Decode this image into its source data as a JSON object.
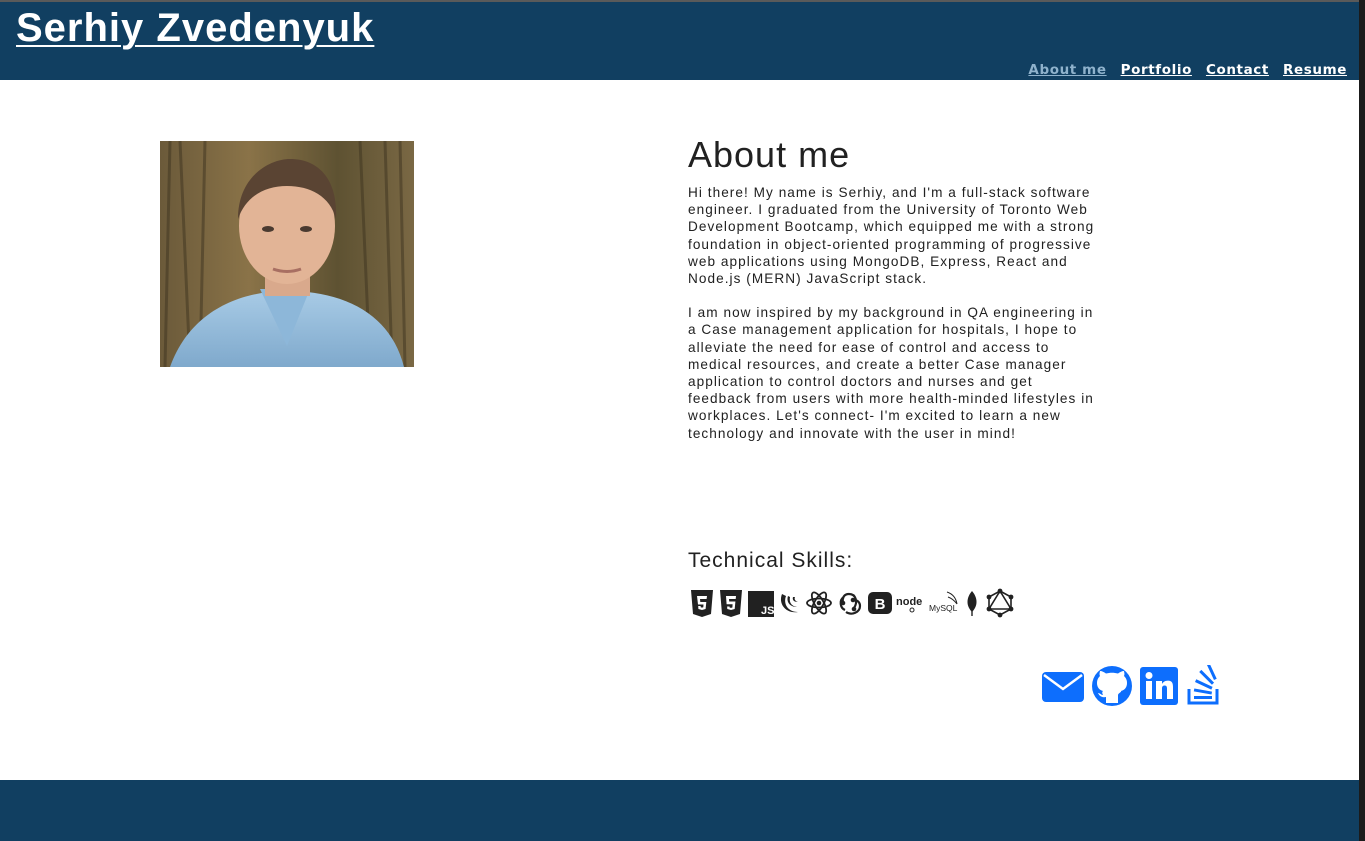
{
  "header": {
    "title": "Serhiy Zvedenyuk",
    "nav": [
      {
        "label": "About me",
        "active": true
      },
      {
        "label": "Portfolio",
        "active": false
      },
      {
        "label": "Contact",
        "active": false
      },
      {
        "label": "Resume",
        "active": false
      }
    ]
  },
  "about": {
    "heading": "About me",
    "paragraph1": "Hi there! My name is Serhiy, and I'm a full-stack software engineer. I graduated from the University of Toronto Web Development Bootcamp, which equipped me with a strong foundation in object-oriented programming of progressive web applications using MongoDB, Express, React and Node.js (MERN) JavaScript stack.",
    "paragraph2": "I am now inspired by my background in QA engineering in a Case management application for hospitals, I hope to alleviate the need for ease of control and access to medical resources, and create a better Case manager application to control doctors and nurses and get feedback from users with more health-minded lifestyles in workplaces. Let's connect- I'm excited to learn a new technology and innovate with the user in mind!"
  },
  "skills": {
    "title": "Technical Skills:",
    "icons": [
      "html5-icon",
      "css3-icon",
      "javascript-icon",
      "jquery-icon",
      "react-icon",
      "redux-icon",
      "bootstrap-icon",
      "nodejs-icon",
      "mysql-icon",
      "mongodb-icon",
      "graphql-icon"
    ],
    "node_text": "node",
    "mysql_text": "MySQL",
    "js_text": "JS",
    "b_text": "B"
  },
  "socials": [
    "email-icon",
    "github-icon",
    "linkedin-icon",
    "stackoverflow-icon"
  ],
  "colors": {
    "header_bg": "#113f61",
    "nav_active": "#8fb2cc",
    "social_blue": "#0d6efd",
    "text": "#212121"
  }
}
